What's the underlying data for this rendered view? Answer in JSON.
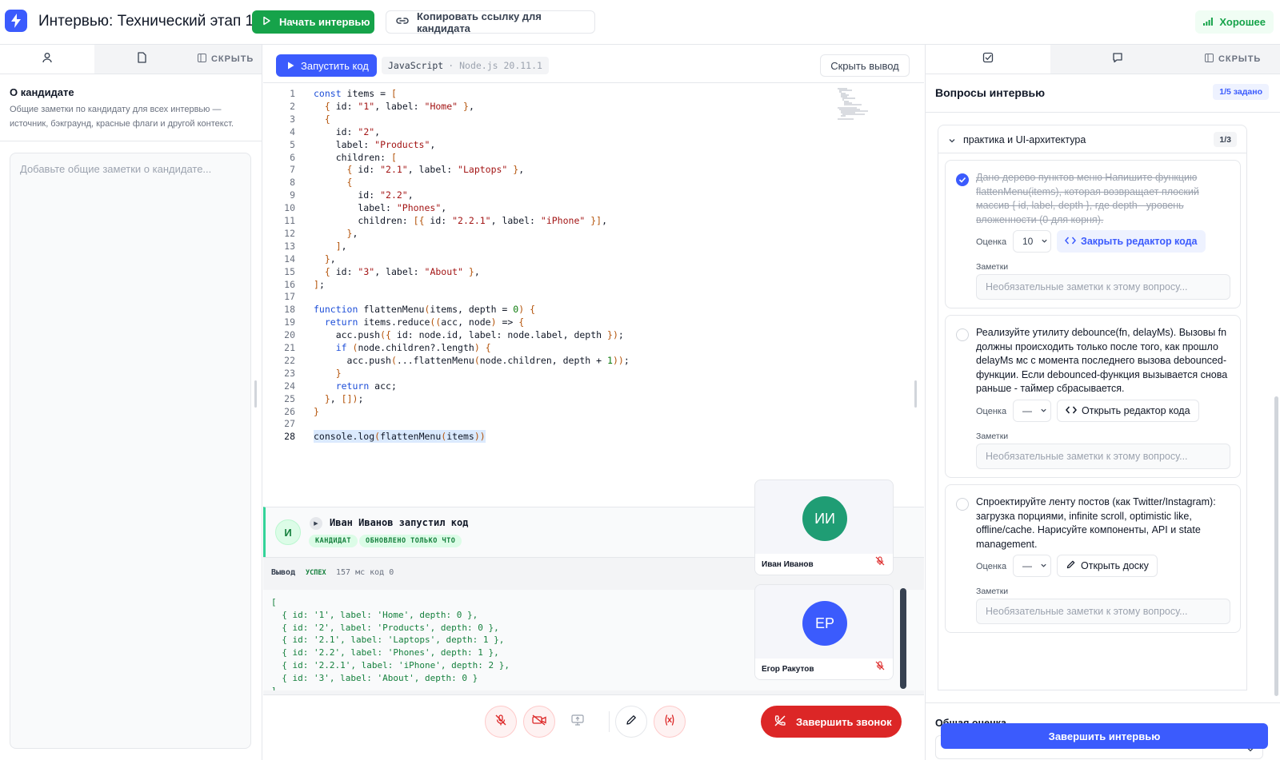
{
  "header": {
    "title": "Интервью: Технический этап 1",
    "start_label": "Начать интервью",
    "copy_label": "Копировать ссылку для кандидата",
    "connection_label": "Хорошее"
  },
  "left_panel": {
    "hide_label": "СКРЫТЬ",
    "section_title": "О кандидате",
    "section_desc": "Общие заметки по кандидату для всех интервью — источник, бэкграунд, красные флаги и другой контекст.",
    "notes_placeholder": "Добавьте общие заметки о кандидате..."
  },
  "editor": {
    "run_label": "Запустить код",
    "language": "JavaScript",
    "runtime": "· Node.js 20.11.1",
    "hide_output_label": "Скрыть вывод",
    "lines": [
      "const items = [",
      "  { id: \"1\", label: \"Home\" },",
      "  {",
      "    id: \"2\",",
      "    label: \"Products\",",
      "    children: [",
      "      { id: \"2.1\", label: \"Laptops\" },",
      "      {",
      "        id: \"2.2\",",
      "        label: \"Phones\",",
      "        children: [{ id: \"2.2.1\", label: \"iPhone\" }],",
      "      },",
      "    ],",
      "  },",
      "  { id: \"3\", label: \"About\" },",
      "];",
      "",
      "function flattenMenu(items, depth = 0) {",
      "  return items.reduce((acc, node) => {",
      "    acc.push({ id: node.id, label: node.label, depth });",
      "    if (node.children?.length) {",
      "      acc.push(...flattenMenu(node.children, depth + 1));",
      "    }",
      "    return acc;",
      "  }, []);",
      "}",
      "",
      "console.log(flattenMenu(items))"
    ]
  },
  "run_event": {
    "avatar": "И",
    "title": "Иван Иванов запустил код",
    "role_badge": "КАНДИДАТ",
    "time_badge": "ОБНОВЛЕНО ТОЛЬКО ЧТО"
  },
  "output": {
    "label": "Вывод",
    "status": "УСПЕХ",
    "meta": "157 мс код 0",
    "lines": [
      "[",
      "  { id: '1', label: 'Home', depth: 0 },",
      "  { id: '2', label: 'Products', depth: 0 },",
      "  { id: '2.1', label: 'Laptops', depth: 1 },",
      "  { id: '2.2', label: 'Phones', depth: 1 },",
      "  { id: '2.2.1', label: 'iPhone', depth: 2 },",
      "  { id: '3', label: 'About', depth: 0 }",
      "]"
    ]
  },
  "participants": [
    {
      "initials": "ИИ",
      "name": "Иван Иванов",
      "color": "#1f9d74"
    },
    {
      "initials": "ЕР",
      "name": "Егор Ракутов",
      "color": "#3b5bfd"
    }
  ],
  "controls": {
    "end_call_label": "Завершить звонок"
  },
  "right_panel": {
    "hide_label": "СКРЫТЬ",
    "title": "Вопросы интервью",
    "progress_badge": "1/5 задано",
    "section_title": "практика и UI-архитектура",
    "section_count": "1/3",
    "score_label": "Оценка",
    "notes_label": "Заметки",
    "notes_placeholder": "Необязательные заметки к этому вопросу...",
    "questions": [
      {
        "text": "Дано дерево пунктов меню Напишите функцию flattenMenu(items), которая возвращает плоский массив { id, label, depth }, где depth - уровень вложенности (0 для корня).",
        "score": "10",
        "button": "Закрыть редактор кода",
        "done": true
      },
      {
        "text": "Реализуйте утилиту debounce(fn, delayMs). Вызовы fn должны происходить только после того, как прошло delayMs мс с момента последнего вызова debounced-функции. Если debounced-функция вызывается снова раньше - таймер сбрасывается.",
        "score": "—",
        "button": "Открыть редактор кода",
        "done": false
      },
      {
        "text": "Спроектируйте ленту постов (как Twitter/Instagram): загрузка порциями, infinite scroll, optimistic like, offline/cache. Нарисуйте компоненты, API и state management.",
        "score": "—",
        "button": "Открыть доску",
        "done": false
      }
    ],
    "overall_label": "Общая оценка",
    "overall_value": "—",
    "finish_label": "Завершить интервью"
  },
  "colors": {
    "accent": "#3b5bfd",
    "success": "#16a34a",
    "danger": "#dc2626"
  }
}
